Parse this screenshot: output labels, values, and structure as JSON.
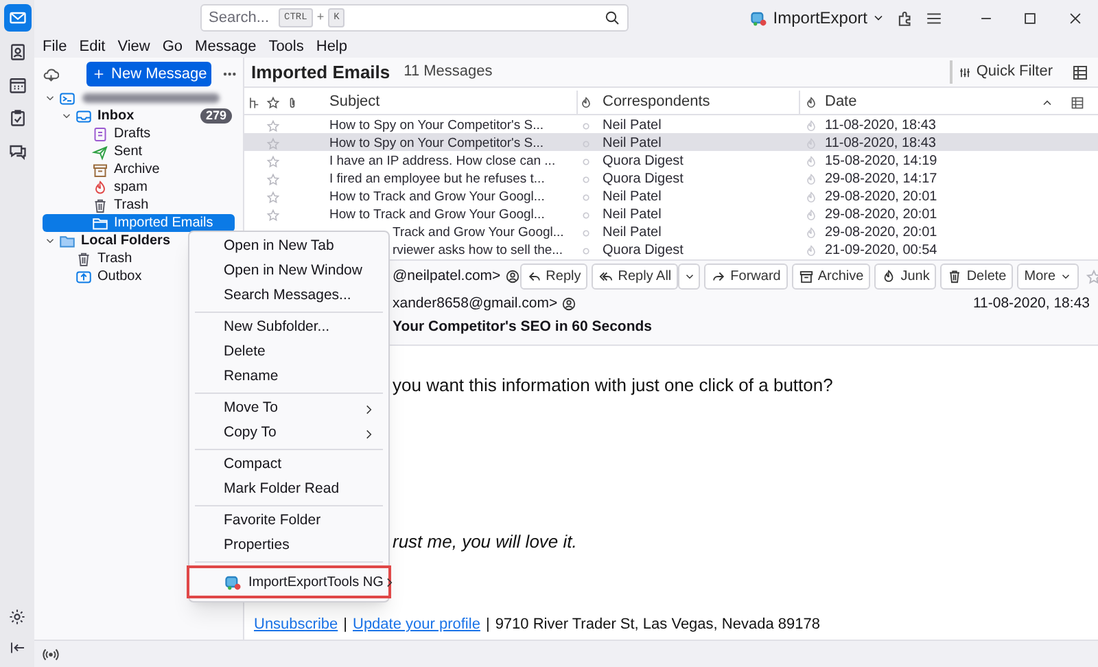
{
  "title_bar": {
    "search_placeholder": "Search...",
    "shortcut": [
      "CTRL",
      "+",
      "K"
    ],
    "account_button": "ImportExport"
  },
  "menu_bar": [
    "File",
    "Edit",
    "View",
    "Go",
    "Message",
    "Tools",
    "Help"
  ],
  "folder_pane": {
    "new_message": "New Message",
    "folders": [
      {
        "kind": "account",
        "blurred": true,
        "selected": false,
        "expanded": true,
        "children": [
          {
            "kind": "inbox",
            "label": "Inbox",
            "count": "279",
            "selected": false,
            "expanded": true,
            "children": [
              {
                "kind": "drafts",
                "label": "Drafts",
                "selected": false
              },
              {
                "kind": "sent",
                "label": "Sent",
                "selected": false
              },
              {
                "kind": "archive",
                "label": "Archive",
                "selected": false
              },
              {
                "kind": "junk",
                "label": "spam",
                "selected": false
              },
              {
                "kind": "trash",
                "label": "Trash",
                "selected": false
              },
              {
                "kind": "folder",
                "label": "Imported Emails",
                "selected": true
              }
            ]
          }
        ]
      },
      {
        "kind": "local",
        "label": "Local Folders",
        "selected": false,
        "expanded": true,
        "children": [
          {
            "kind": "trash",
            "label": "Trash",
            "selected": false
          },
          {
            "kind": "outbox",
            "label": "Outbox",
            "selected": false
          }
        ]
      }
    ]
  },
  "message_list": {
    "title": "Imported Emails",
    "count": "11 Messages",
    "quick_filter": "Quick Filter",
    "columns": [
      "Subject",
      "Correspondents",
      "Date"
    ],
    "rows": [
      {
        "subject": "How to Spy on Your Competitor's S...",
        "correspondent": "Neil Patel",
        "date": "11-08-2020, 18:43",
        "selected": false,
        "covered": false
      },
      {
        "subject": "How to Spy on Your Competitor's S...",
        "correspondent": "Neil Patel",
        "date": "11-08-2020, 18:43",
        "selected": true,
        "covered": false
      },
      {
        "subject": "I have an IP address. How close can ...",
        "correspondent": "Quora Digest",
        "date": "15-08-2020, 14:19",
        "selected": false,
        "covered": false
      },
      {
        "subject": "I fired an employee but he refuses t...",
        "correspondent": "Quora Digest",
        "date": "29-08-2020, 14:17",
        "selected": false,
        "covered": false
      },
      {
        "subject": "How to Track and Grow Your Googl...",
        "correspondent": "Neil Patel",
        "date": "29-08-2020, 20:01",
        "selected": false,
        "covered": false
      },
      {
        "subject": "How to Track and Grow Your Googl...",
        "correspondent": "Neil Patel",
        "date": "29-08-2020, 20:01",
        "selected": false,
        "covered": false
      },
      {
        "subject": "Track and Grow Your Googl...",
        "correspondent": "Neil Patel",
        "date": "29-08-2020, 20:01",
        "selected": false,
        "covered": true
      },
      {
        "subject": "rviewer asks how to sell the...",
        "correspondent": "Quora Digest",
        "date": "21-09-2020, 00:54",
        "selected": false,
        "covered": true
      }
    ]
  },
  "preview": {
    "actions": [
      {
        "kind": "reply",
        "label": "Reply"
      },
      {
        "kind": "reply_all",
        "label": "Reply All"
      },
      {
        "kind": "forward",
        "label": "Forward"
      },
      {
        "kind": "archive",
        "label": "Archive"
      },
      {
        "kind": "junk",
        "label": "Junk"
      },
      {
        "kind": "delete",
        "label": "Delete"
      },
      {
        "kind": "more",
        "label": "More"
      }
    ],
    "from": "@neilpatel.com>",
    "to": "xander8658@gmail.com>",
    "date": "11-08-2020, 18:43",
    "subject": "Your Competitor's SEO in 60 Seconds",
    "body": [
      {
        "text": "you want this information with just one click of a button?",
        "italic": false
      },
      {
        "text": "rust me, you will love it.",
        "italic": true
      }
    ],
    "footer": {
      "links": [
        "Unsubscribe",
        "Update your profile"
      ],
      "separator": "|",
      "address": "9710 River Trader St, Las Vegas, Nevada 89178"
    }
  },
  "context_menu": [
    [
      {
        "label": "Open in New Tab",
        "submenu": false,
        "highlighted": false
      },
      {
        "label": "Open in New Window",
        "submenu": false,
        "highlighted": false
      },
      {
        "label": "Search Messages...",
        "submenu": false,
        "highlighted": false
      }
    ],
    [
      {
        "label": "New Subfolder...",
        "submenu": false,
        "highlighted": false
      },
      {
        "label": "Delete",
        "submenu": false,
        "highlighted": false
      },
      {
        "label": "Rename",
        "submenu": false,
        "highlighted": false
      }
    ],
    [
      {
        "label": "Move To",
        "submenu": true,
        "highlighted": false
      },
      {
        "label": "Copy To",
        "submenu": true,
        "highlighted": false
      }
    ],
    [
      {
        "label": "Compact",
        "submenu": false,
        "highlighted": false
      },
      {
        "label": "Mark Folder Read",
        "submenu": false,
        "highlighted": false
      }
    ],
    [
      {
        "label": "Favorite Folder",
        "submenu": false,
        "highlighted": false
      },
      {
        "label": "Properties",
        "submenu": false,
        "highlighted": false
      }
    ],
    [
      {
        "label": "ImportExportTools NG",
        "submenu": true,
        "highlighted": true,
        "icon": true
      }
    ]
  ]
}
